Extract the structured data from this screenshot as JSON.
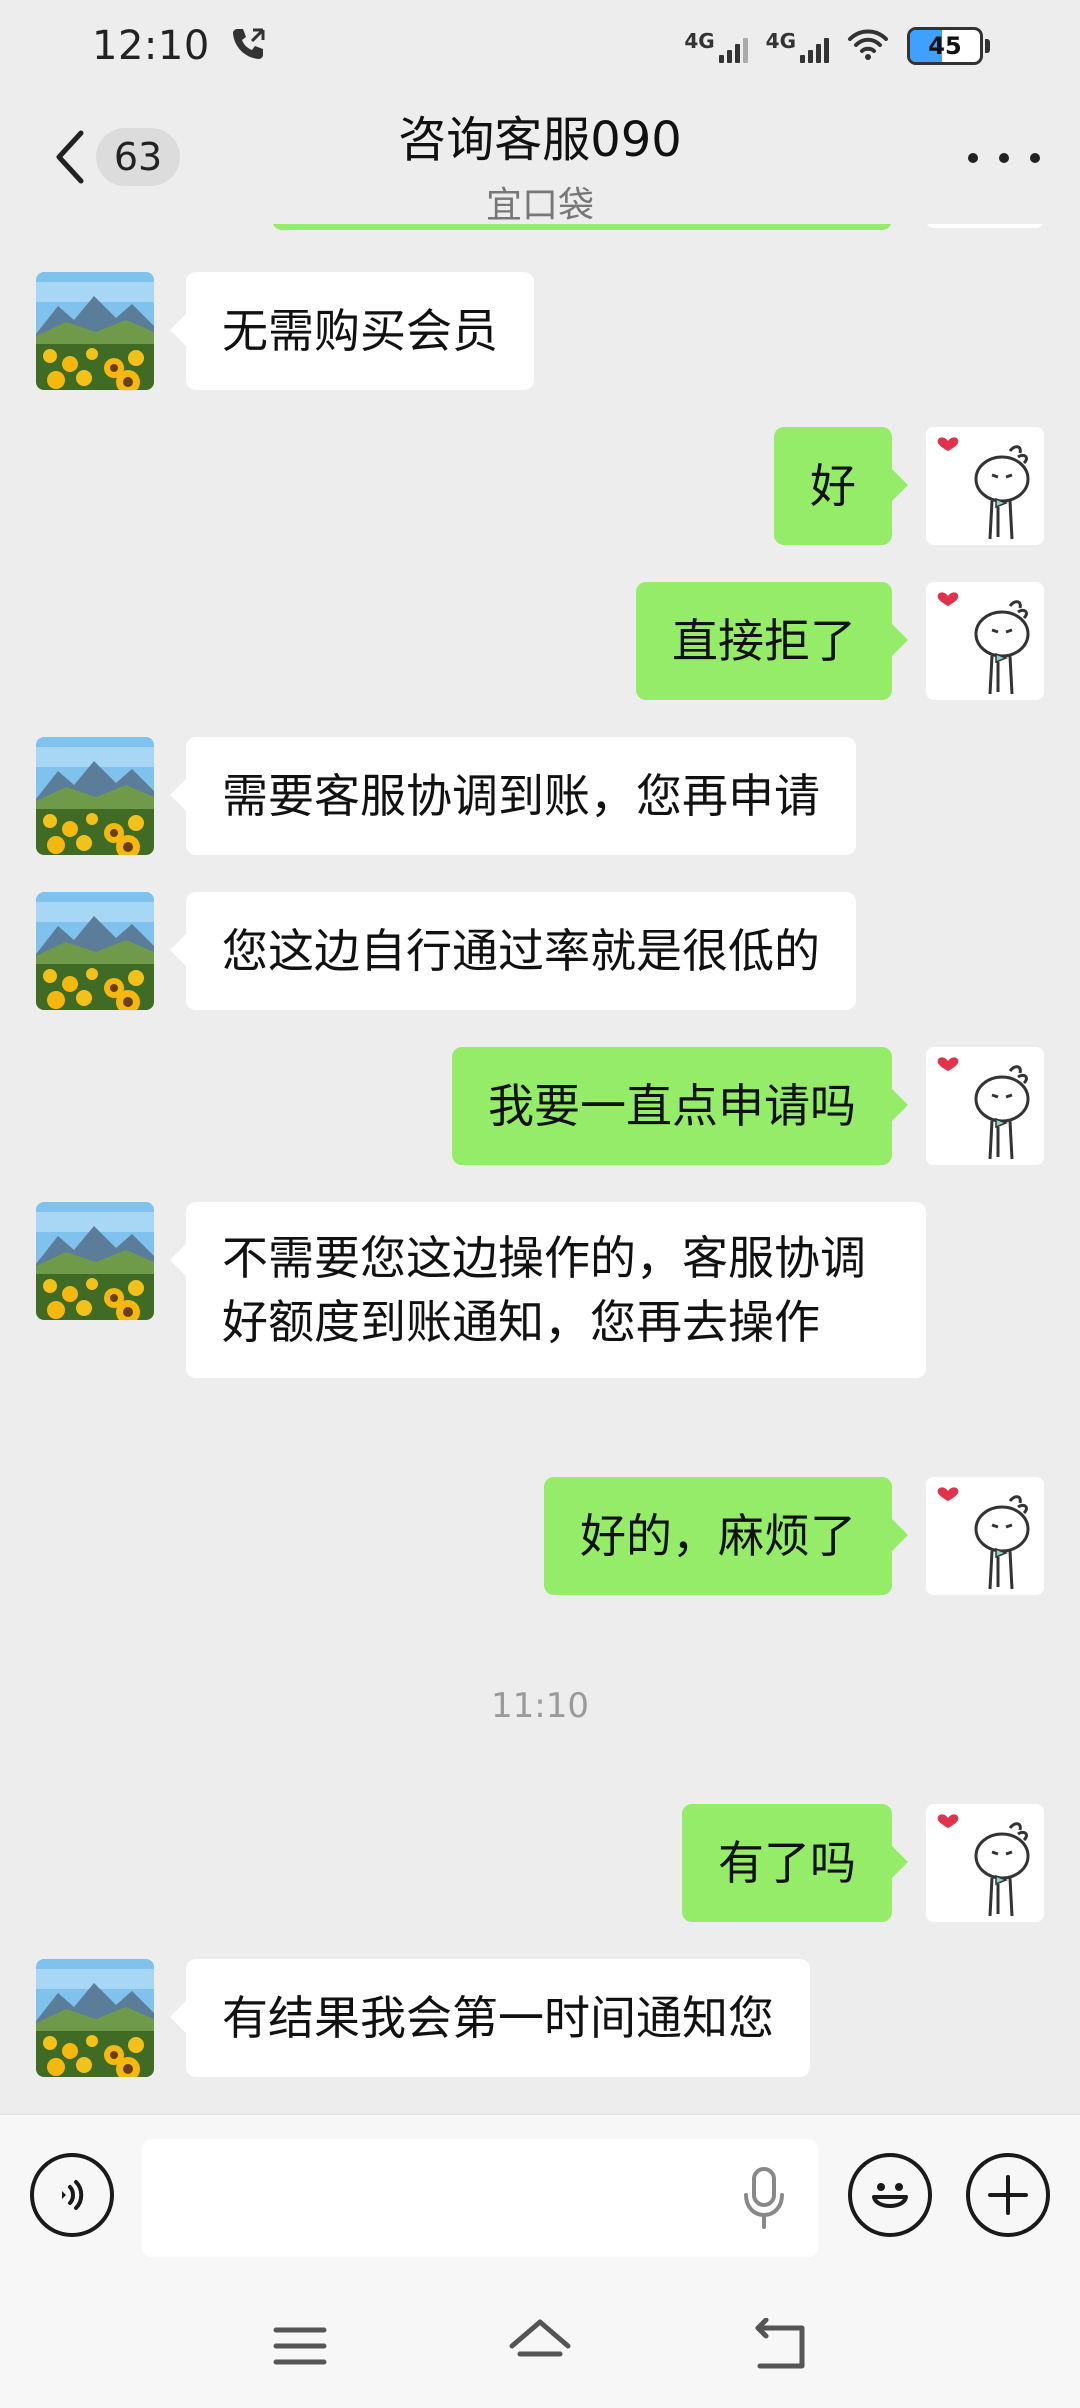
{
  "status_bar": {
    "time": "12:10",
    "network1": "4G",
    "network2": "4G",
    "battery": "45",
    "battery_level": 0.45,
    "battery_color": "#3ea0ff"
  },
  "header": {
    "unread_count": "63",
    "title": "咨询客服090",
    "subtitle": "宜口袋"
  },
  "messages": [
    {
      "dir": "in",
      "text": "无需购买会员"
    },
    {
      "dir": "out",
      "text": "好"
    },
    {
      "dir": "out",
      "text": "直接拒了"
    },
    {
      "dir": "in",
      "text": "需要客服协调到账，您再申请"
    },
    {
      "dir": "in",
      "text": "您这边自行通过率就是很低的"
    },
    {
      "dir": "out",
      "text": "我要一直点申请吗"
    },
    {
      "dir": "in",
      "text": "不需要您这边操作的，客服协调好额度到账通知，您再去操作"
    },
    {
      "dir": "out",
      "text": "好的，麻烦了"
    },
    {
      "dir": "out",
      "text": "有了吗"
    },
    {
      "dir": "in",
      "text": "有结果我会第一时间通知您"
    }
  ],
  "time_divider": "11:10",
  "input": {
    "placeholder": ""
  },
  "colors": {
    "background": "#ededed",
    "outgoing_bubble": "#95ec69",
    "incoming_bubble": "#ffffff"
  },
  "icons": [
    "back-icon",
    "more-icon",
    "voice-icon",
    "mic-icon",
    "emoji-icon",
    "plus-icon",
    "menu-icon",
    "home-icon",
    "back-nav-icon"
  ]
}
